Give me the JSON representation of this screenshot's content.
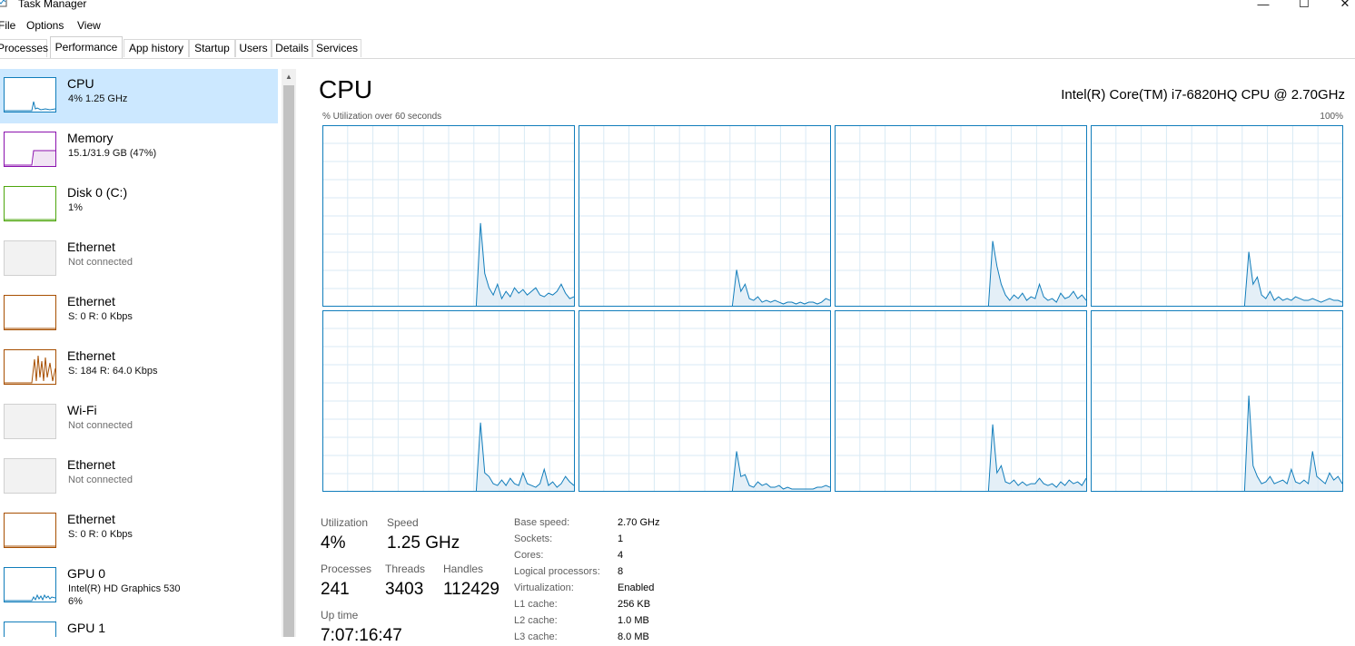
{
  "window": {
    "title": "Task Manager",
    "minimize_glyph": "—",
    "maximize_glyph": "☐",
    "close_glyph": "✕"
  },
  "menu": {
    "items": [
      "File",
      "Options",
      "View"
    ]
  },
  "tabs": [
    "Processes",
    "Performance",
    "App history",
    "Startup",
    "Users",
    "Details",
    "Services"
  ],
  "active_tab": "Performance",
  "sidebar": {
    "items": [
      {
        "name": "CPU",
        "sub": "4%  1.25 GHz",
        "sub2": "",
        "color": "#117dbb",
        "selected": true,
        "muted": false
      },
      {
        "name": "Memory",
        "sub": "15.1/31.9 GB (47%)",
        "sub2": "",
        "color": "#8b12ae",
        "selected": false,
        "muted": false
      },
      {
        "name": "Disk 0 (C:)",
        "sub": "1%",
        "sub2": "",
        "color": "#4da60c",
        "selected": false,
        "muted": false
      },
      {
        "name": "Ethernet",
        "sub": "Not connected",
        "sub2": "",
        "color": "#d0d0d0",
        "selected": false,
        "muted": true
      },
      {
        "name": "Ethernet",
        "sub": "S: 0 R: 0 Kbps",
        "sub2": "",
        "color": "#a74f01",
        "selected": false,
        "muted": false
      },
      {
        "name": "Ethernet",
        "sub": "S: 184 R: 64.0 Kbps",
        "sub2": "",
        "color": "#a74f01",
        "selected": false,
        "muted": false
      },
      {
        "name": "Wi-Fi",
        "sub": "Not connected",
        "sub2": "",
        "color": "#d0d0d0",
        "selected": false,
        "muted": true
      },
      {
        "name": "Ethernet",
        "sub": "Not connected",
        "sub2": "",
        "color": "#d0d0d0",
        "selected": false,
        "muted": true
      },
      {
        "name": "Ethernet",
        "sub": "S: 0 R: 0 Kbps",
        "sub2": "",
        "color": "#a74f01",
        "selected": false,
        "muted": false
      },
      {
        "name": "GPU 0",
        "sub": "Intel(R) HD Graphics 530",
        "sub2": "6%",
        "color": "#117dbb",
        "selected": false,
        "muted": false
      },
      {
        "name": "GPU 1",
        "sub": "",
        "sub2": "",
        "color": "#117dbb",
        "selected": false,
        "muted": false
      }
    ]
  },
  "main": {
    "heading": "CPU",
    "model": "Intel(R) Core(TM) i7-6820HQ CPU @ 2.70GHz",
    "util_label": "% Utilization over 60 seconds",
    "util_max": "100%",
    "accent": "#117dbb",
    "grid_color": "#d9eaf4",
    "fill_color": "#d8e8f3"
  },
  "chart_data": {
    "type": "line",
    "title": "",
    "xlabel": "% Utilization over 60 seconds",
    "ylabel": "",
    "ylim": [
      0,
      100
    ],
    "series": [
      {
        "values": [
          0,
          0,
          0,
          0,
          0,
          0,
          0,
          0,
          0,
          0,
          0,
          0,
          0,
          0,
          0,
          0,
          0,
          0,
          0,
          0,
          0,
          0,
          0,
          0,
          0,
          0,
          0,
          0,
          0,
          0,
          0,
          0,
          0,
          0,
          0,
          0,
          0,
          46,
          18,
          10,
          6,
          12,
          4,
          8,
          5,
          10,
          7,
          9,
          6,
          8,
          10,
          6,
          5,
          7,
          6,
          8,
          12,
          7,
          4,
          5
        ]
      },
      {
        "values": [
          0,
          0,
          0,
          0,
          0,
          0,
          0,
          0,
          0,
          0,
          0,
          0,
          0,
          0,
          0,
          0,
          0,
          0,
          0,
          0,
          0,
          0,
          0,
          0,
          0,
          0,
          0,
          0,
          0,
          0,
          0,
          0,
          0,
          0,
          0,
          0,
          0,
          20,
          8,
          12,
          4,
          3,
          5,
          2,
          3,
          2,
          3,
          2,
          1,
          2,
          2,
          1,
          2,
          1,
          2,
          2,
          1,
          2,
          4,
          3
        ]
      },
      {
        "values": [
          0,
          0,
          0,
          0,
          0,
          0,
          0,
          0,
          0,
          0,
          0,
          0,
          0,
          0,
          0,
          0,
          0,
          0,
          0,
          0,
          0,
          0,
          0,
          0,
          0,
          0,
          0,
          0,
          0,
          0,
          0,
          0,
          0,
          0,
          0,
          0,
          0,
          36,
          22,
          12,
          6,
          3,
          6,
          4,
          7,
          3,
          5,
          4,
          12,
          5,
          3,
          4,
          2,
          7,
          4,
          5,
          8,
          4,
          6,
          3
        ]
      },
      {
        "values": [
          0,
          0,
          0,
          0,
          0,
          0,
          0,
          0,
          0,
          0,
          0,
          0,
          0,
          0,
          0,
          0,
          0,
          0,
          0,
          0,
          0,
          0,
          0,
          0,
          0,
          0,
          0,
          0,
          0,
          0,
          0,
          0,
          0,
          0,
          0,
          0,
          0,
          30,
          12,
          16,
          6,
          4,
          8,
          3,
          5,
          3,
          4,
          3,
          5,
          4,
          3,
          3,
          4,
          3,
          2,
          3,
          4,
          3,
          3,
          2
        ]
      },
      {
        "values": [
          0,
          0,
          0,
          0,
          0,
          0,
          0,
          0,
          0,
          0,
          0,
          0,
          0,
          0,
          0,
          0,
          0,
          0,
          0,
          0,
          0,
          0,
          0,
          0,
          0,
          0,
          0,
          0,
          0,
          0,
          0,
          0,
          0,
          0,
          0,
          0,
          0,
          38,
          10,
          8,
          4,
          3,
          6,
          3,
          7,
          4,
          3,
          10,
          4,
          3,
          2,
          4,
          12,
          3,
          5,
          2,
          4,
          8,
          5,
          3
        ]
      },
      {
        "values": [
          0,
          0,
          0,
          0,
          0,
          0,
          0,
          0,
          0,
          0,
          0,
          0,
          0,
          0,
          0,
          0,
          0,
          0,
          0,
          0,
          0,
          0,
          0,
          0,
          0,
          0,
          0,
          0,
          0,
          0,
          0,
          0,
          0,
          0,
          0,
          0,
          0,
          22,
          8,
          9,
          3,
          2,
          5,
          3,
          4,
          2,
          2,
          3,
          1,
          2,
          1,
          1,
          1,
          1,
          1,
          1,
          2,
          2,
          3,
          2
        ]
      },
      {
        "values": [
          0,
          0,
          0,
          0,
          0,
          0,
          0,
          0,
          0,
          0,
          0,
          0,
          0,
          0,
          0,
          0,
          0,
          0,
          0,
          0,
          0,
          0,
          0,
          0,
          0,
          0,
          0,
          0,
          0,
          0,
          0,
          0,
          0,
          0,
          0,
          0,
          0,
          37,
          10,
          14,
          5,
          4,
          6,
          3,
          5,
          3,
          4,
          4,
          7,
          4,
          3,
          4,
          2,
          5,
          3,
          6,
          4,
          5,
          3,
          7
        ]
      },
      {
        "values": [
          0,
          0,
          0,
          0,
          0,
          0,
          0,
          0,
          0,
          0,
          0,
          0,
          0,
          0,
          0,
          0,
          0,
          0,
          0,
          0,
          0,
          0,
          0,
          0,
          0,
          0,
          0,
          0,
          0,
          0,
          0,
          0,
          0,
          0,
          0,
          0,
          0,
          53,
          14,
          8,
          4,
          5,
          8,
          4,
          5,
          6,
          4,
          12,
          5,
          4,
          6,
          4,
          22,
          8,
          6,
          4,
          10,
          6,
          8,
          4
        ]
      }
    ]
  },
  "stats": {
    "utilization": {
      "label": "Utilization",
      "value": "4%"
    },
    "speed": {
      "label": "Speed",
      "value": "1.25 GHz"
    },
    "processes": {
      "label": "Processes",
      "value": "241"
    },
    "threads": {
      "label": "Threads",
      "value": "3403"
    },
    "handles": {
      "label": "Handles",
      "value": "112429"
    },
    "uptime": {
      "label": "Up time",
      "value": "7:07:16:47"
    }
  },
  "specs": [
    {
      "label": "Base speed:",
      "value": "2.70 GHz"
    },
    {
      "label": "Sockets:",
      "value": "1"
    },
    {
      "label": "Cores:",
      "value": "4"
    },
    {
      "label": "Logical processors:",
      "value": "8"
    },
    {
      "label": "Virtualization:",
      "value": "Enabled"
    },
    {
      "label": "L1 cache:",
      "value": "256 KB"
    },
    {
      "label": "L2 cache:",
      "value": "1.0 MB"
    },
    {
      "label": "L3 cache:",
      "value": "8.0 MB"
    }
  ]
}
